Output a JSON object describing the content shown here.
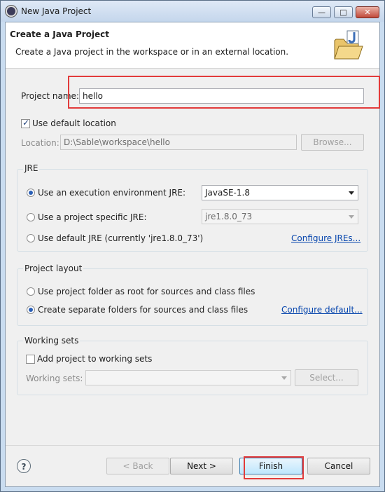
{
  "window": {
    "title": "New Java Project"
  },
  "header": {
    "title": "Create a Java Project",
    "description": "Create a Java project in the workspace or in an external location."
  },
  "project_name": {
    "label": "Project name:",
    "value": "hello"
  },
  "location": {
    "use_default_label": "Use default location",
    "use_default_checked": true,
    "label": "Location:",
    "value": "D:\\Sable\\workspace\\hello",
    "browse_label": "Browse..."
  },
  "jre": {
    "group_label": "JRE",
    "option_env_label": "Use an execution environment JRE:",
    "env_selected": "JavaSE-1.8",
    "option_project_label": "Use a project specific JRE:",
    "project_selected": "jre1.8.0_73",
    "option_default_label": "Use default JRE (currently 'jre1.8.0_73')",
    "configure_link": "Configure JREs..."
  },
  "layout": {
    "group_label": "Project layout",
    "option_root_label": "Use project folder as root for sources and class files",
    "option_separate_label": "Create separate folders for sources and class files",
    "configure_link": "Configure default..."
  },
  "working_sets": {
    "group_label": "Working sets",
    "add_label": "Add project to working sets",
    "sets_label": "Working sets:",
    "select_label": "Select..."
  },
  "footer": {
    "help_label": "?",
    "back_label": "< Back",
    "next_label": "Next >",
    "finish_label": "Finish",
    "cancel_label": "Cancel"
  },
  "colors": {
    "highlight": "#e23b3b",
    "link": "#0645ad"
  }
}
